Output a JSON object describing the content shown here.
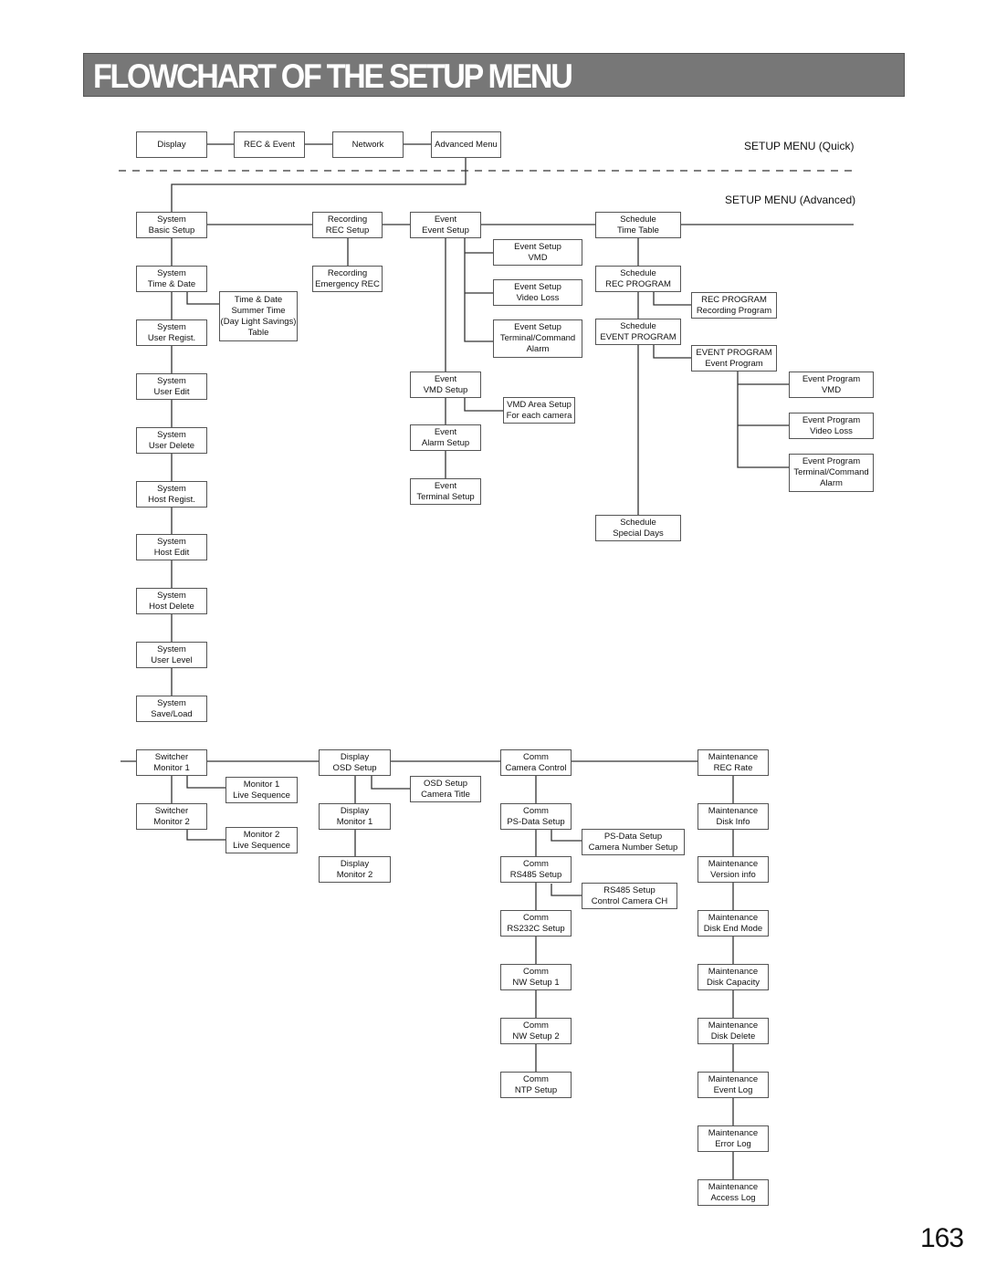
{
  "title": "FLOWCHART OF THE SETUP MENU",
  "page_number": "163",
  "section_labels": {
    "quick": "SETUP MENU (Quick)",
    "advanced": "SETUP MENU (Advanced)"
  },
  "quick_menu": [
    "Display",
    "REC & Event",
    "Network",
    "Advanced Menu"
  ],
  "nodes": {
    "sys_basic": [
      "System",
      "Basic Setup"
    ],
    "sys_time": [
      "System",
      "Time & Date"
    ],
    "sys_user_regist": [
      "System",
      "User Regist."
    ],
    "sys_user_edit": [
      "System",
      "User Edit"
    ],
    "sys_user_delete": [
      "System",
      "User Delete"
    ],
    "sys_host_regist": [
      "System",
      "Host Regist."
    ],
    "sys_host_edit": [
      "System",
      "Host Edit"
    ],
    "sys_host_delete": [
      "System",
      "Host Delete"
    ],
    "sys_user_level": [
      "System",
      "User Level"
    ],
    "sys_save_load": [
      "System",
      "Save/Load"
    ],
    "time_summer": [
      "Time & Date",
      "Summer Time",
      "(Day Light Savings)",
      "Table"
    ],
    "rec_setup": [
      "Recording",
      "REC Setup"
    ],
    "rec_emergency": [
      "Recording",
      "Emergency REC"
    ],
    "evt_setup": [
      "Event",
      "Event Setup"
    ],
    "evt_vmd": [
      "Event Setup",
      "VMD"
    ],
    "evt_video_loss": [
      "Event Setup",
      "Video Loss"
    ],
    "evt_terminal": [
      "Event Setup",
      "Terminal/Command",
      "Alarm"
    ],
    "evt_vmd_setup": [
      "Event",
      "VMD Setup"
    ],
    "vmd_area": [
      "VMD Area Setup",
      "For each camera"
    ],
    "evt_alarm_setup": [
      "Event",
      "Alarm Setup"
    ],
    "evt_terminal_setup": [
      "Event",
      "Terminal Setup"
    ],
    "sch_time_table": [
      "Schedule",
      "Time Table"
    ],
    "sch_rec_program": [
      "Schedule",
      "REC PROGRAM"
    ],
    "rec_program_rec": [
      "REC PROGRAM",
      "Recording Program"
    ],
    "sch_event_program": [
      "Schedule",
      "EVENT PROGRAM"
    ],
    "event_program_evt": [
      "EVENT PROGRAM",
      "Event Program"
    ],
    "ep_vmd": [
      "Event Program",
      "VMD"
    ],
    "ep_video_loss": [
      "Event Program",
      "Video Loss"
    ],
    "ep_terminal": [
      "Event Program",
      "Terminal/Command",
      "Alarm"
    ],
    "sch_special_days": [
      "Schedule",
      "Special Days"
    ],
    "sw_monitor1": [
      "Switcher",
      "Monitor 1"
    ],
    "mon1_live": [
      "Monitor 1",
      "Live Sequence"
    ],
    "sw_monitor2": [
      "Switcher",
      "Monitor 2"
    ],
    "mon2_live": [
      "Monitor 2",
      "Live Sequence"
    ],
    "disp_osd": [
      "Display",
      "OSD Setup"
    ],
    "osd_camera_title": [
      "OSD Setup",
      "Camera Title"
    ],
    "disp_monitor1": [
      "Display",
      "Monitor 1"
    ],
    "disp_monitor2": [
      "Display",
      "Monitor 2"
    ],
    "comm_camera": [
      "Comm",
      "Camera Control"
    ],
    "comm_psdata": [
      "Comm",
      "PS-Data Setup"
    ],
    "psdata_camnum": [
      "PS-Data Setup",
      "Camera Number Setup"
    ],
    "comm_rs485": [
      "Comm",
      "RS485 Setup"
    ],
    "rs485_ctrl": [
      "RS485 Setup",
      "Control Camera CH"
    ],
    "comm_rs232c": [
      "Comm",
      "RS232C Setup"
    ],
    "comm_nw1": [
      "Comm",
      "NW Setup 1"
    ],
    "comm_nw2": [
      "Comm",
      "NW Setup 2"
    ],
    "comm_ntp": [
      "Comm",
      "NTP Setup"
    ],
    "mnt_rec_rate": [
      "Maintenance",
      "REC Rate"
    ],
    "mnt_disk_info": [
      "Maintenance",
      "Disk Info"
    ],
    "mnt_version": [
      "Maintenance",
      "Version info"
    ],
    "mnt_disk_end": [
      "Maintenance",
      "Disk End Mode"
    ],
    "mnt_disk_cap": [
      "Maintenance",
      "Disk Capacity"
    ],
    "mnt_disk_delete": [
      "Maintenance",
      "Disk Delete"
    ],
    "mnt_event_log": [
      "Maintenance",
      "Event Log"
    ],
    "mnt_error_log": [
      "Maintenance",
      "Error Log"
    ],
    "mnt_access_log": [
      "Maintenance",
      "Access Log"
    ]
  }
}
